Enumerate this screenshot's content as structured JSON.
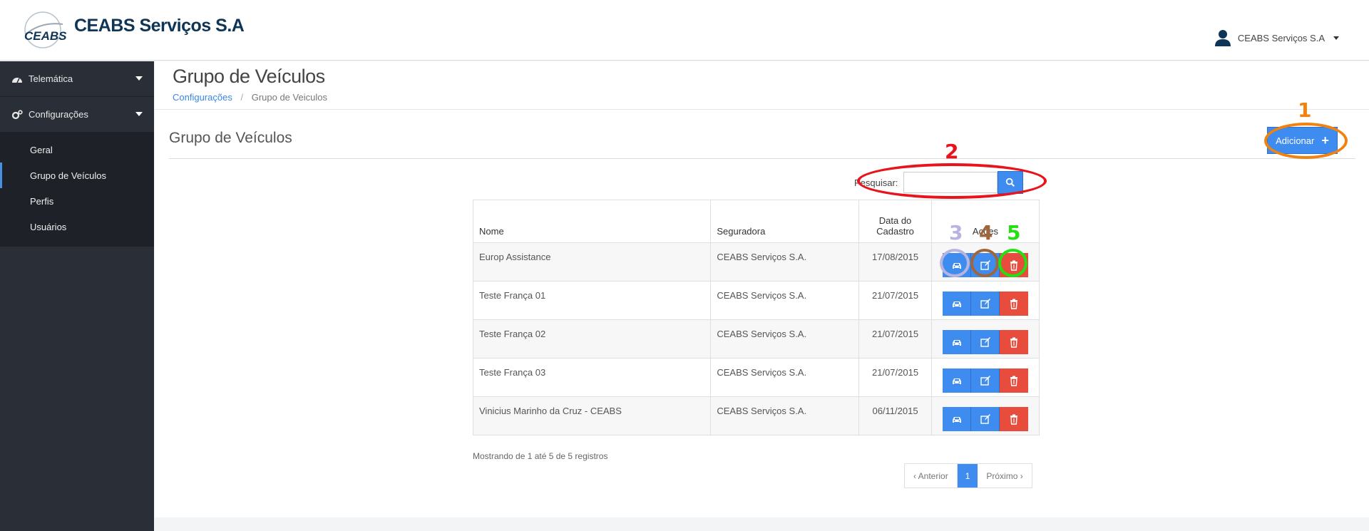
{
  "header": {
    "brand": "CEABS Serviços S.A",
    "logo_text": "CEABS",
    "user_name": "CEABS Serviços S.A"
  },
  "sidebar": {
    "items": [
      {
        "label": "Telemática",
        "icon": "dashboard-icon"
      },
      {
        "label": "Configurações",
        "icon": "cogs-icon"
      }
    ],
    "subitems": [
      {
        "label": "Geral"
      },
      {
        "label": "Grupo de Veículos",
        "active": true
      },
      {
        "label": "Perfis"
      },
      {
        "label": "Usuários"
      }
    ]
  },
  "page": {
    "title": "Grupo de Veículos",
    "breadcrumb_link": "Configurações",
    "breadcrumb_current": "Grupo de Veiculos",
    "panel_title": "Grupo de Veículos",
    "add_label": "Adicionar"
  },
  "search": {
    "label": "Pesquisar:",
    "value": ""
  },
  "table": {
    "headers": {
      "name": "Nome",
      "insurer": "Seguradora",
      "date_line1": "Data do",
      "date_line2": "Cadastro",
      "actions": "Ações"
    },
    "rows": [
      {
        "name": "Europ Assistance",
        "insurer": "CEABS Serviços S.A.",
        "date": "17/08/2015"
      },
      {
        "name": "Teste França 01",
        "insurer": "CEABS Serviços S.A.",
        "date": "21/07/2015"
      },
      {
        "name": "Teste França 02",
        "insurer": "CEABS Serviços S.A.",
        "date": "21/07/2015"
      },
      {
        "name": "Teste França 03",
        "insurer": "CEABS Serviços S.A.",
        "date": "21/07/2015"
      },
      {
        "name": "Vinicius Marinho da Cruz - CEABS",
        "insurer": "CEABS Serviços S.A.",
        "date": "06/11/2015"
      }
    ]
  },
  "footer": {
    "info": "Mostrando de 1 até 5 de 5 registros",
    "prev": "‹ Anterior",
    "page": "1",
    "next": "Próximo ›"
  },
  "annotations": {
    "n1": "1",
    "n2": "2",
    "n3": "3",
    "n4": "4",
    "n5": "5",
    "color1": "#f0820f",
    "color2": "#e8131b",
    "color3": "#b7b5e0",
    "color4": "#a0663a",
    "color5": "#22e012"
  },
  "colors": {
    "primary": "#3f8cf0",
    "danger": "#e74c3c",
    "sidebar": "#2a2e36",
    "brand": "#0f3556"
  }
}
